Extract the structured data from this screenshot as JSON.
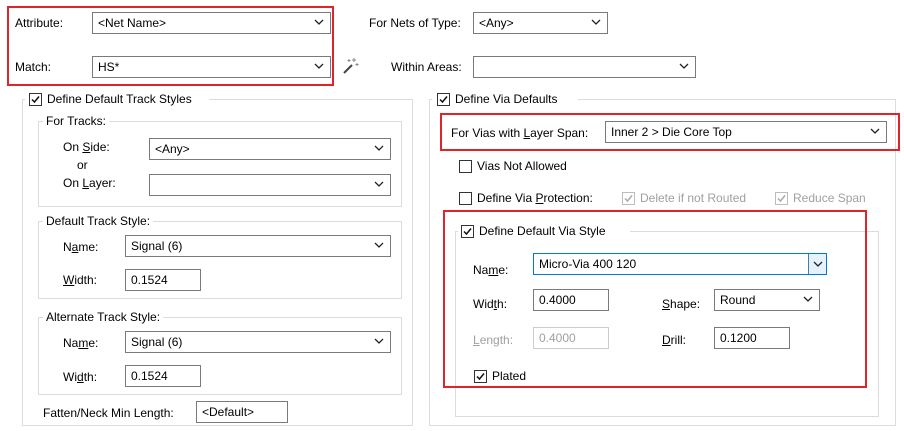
{
  "top": {
    "attribute_label": "Attribute:",
    "attribute_value": "<Net Name>",
    "match_label": "Match:",
    "match_value": "HS*",
    "nets_type_label": "For Nets of Type:",
    "nets_type_value": "<Any>",
    "within_areas_label": "Within Areas:",
    "within_areas_value": ""
  },
  "tracks": {
    "define_label": "Define Default Track Styles",
    "for_tracks_title": "For Tracks:",
    "on_side_label": "On Side:",
    "on_side_value": "<Any>",
    "or_label": "or",
    "on_layer_label": "On Layer:",
    "on_layer_value": "",
    "default_title": "Default Track Style:",
    "name_label": "Name:",
    "default_name": "Signal (6)",
    "width_label": "Width:",
    "default_width": "0.1524",
    "alternate_title": "Alternate Track Style:",
    "alt_name": "Signal (6)",
    "alt_width": "0.1524",
    "fatten_label": "Fatten/Neck Min Length:",
    "fatten_value": "<Default>"
  },
  "vias": {
    "define_label": "Define Via Defaults",
    "layer_span_label": "For Vias with Layer Span:",
    "layer_span_value": "Inner 2 > Die Core Top",
    "not_allowed_label": "Vias Not Allowed",
    "protection_label": "Define Via Protection:",
    "delete_label": "Delete if not Routed",
    "reduce_label": "Reduce Span",
    "default_style_label": "Define Default Via Style",
    "name_label": "Name:",
    "name_value": "Micro-Via 400 120",
    "width_label": "Width:",
    "width_value": "0.4000",
    "shape_label": "Shape:",
    "shape_value": "Round",
    "length_label": "Length:",
    "length_value": "0.4000",
    "drill_label": "Drill:",
    "drill_value": "0.1200",
    "plated_label": "Plated"
  },
  "colors": {
    "highlight_box": "#e0242b",
    "focus_border": "#0078d7"
  }
}
